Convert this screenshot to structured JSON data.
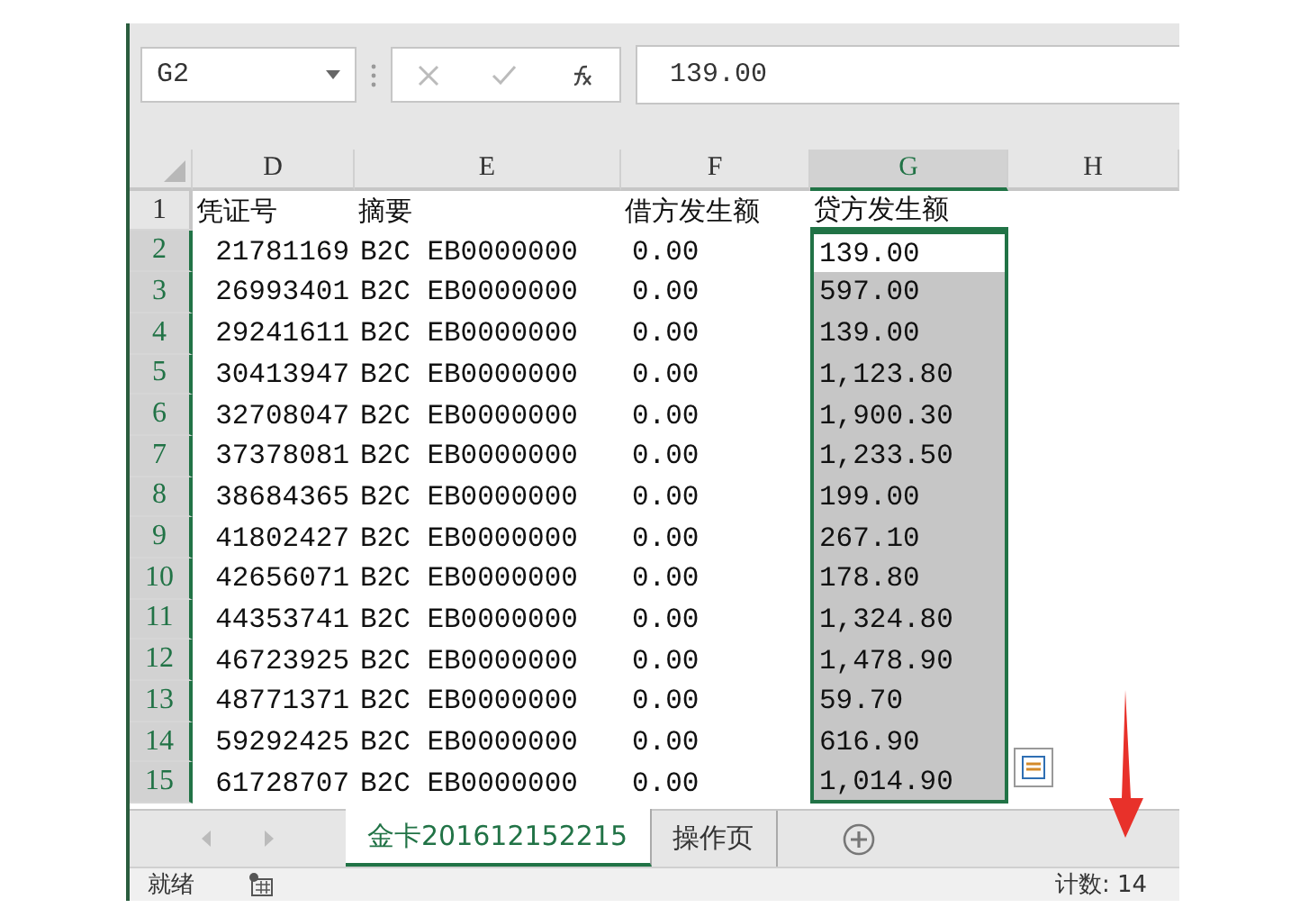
{
  "formula_bar": {
    "name_box": "G2",
    "formula": "139.00"
  },
  "columns": [
    {
      "label": "D",
      "selected": false
    },
    {
      "label": "E",
      "selected": false
    },
    {
      "label": "F",
      "selected": false
    },
    {
      "label": "G",
      "selected": true
    },
    {
      "label": "H",
      "selected": false
    }
  ],
  "header_row": {
    "num": "1",
    "cells": [
      "凭证号",
      "摘要",
      "借方发生额",
      "贷方发生额"
    ]
  },
  "rows": [
    {
      "num": "2",
      "d": "21781169",
      "e": "B2C EB0000000",
      "f": "0.00",
      "g": "139.00",
      "selected": true,
      "active": true
    },
    {
      "num": "3",
      "d": "26993401",
      "e": "B2C EB0000000",
      "f": "0.00",
      "g": "597.00",
      "selected": true,
      "active": false
    },
    {
      "num": "4",
      "d": "29241611",
      "e": "B2C EB0000000",
      "f": "0.00",
      "g": "139.00",
      "selected": true,
      "active": false
    },
    {
      "num": "5",
      "d": "30413947",
      "e": "B2C EB0000000",
      "f": "0.00",
      "g": "1,123.80",
      "selected": true,
      "active": false
    },
    {
      "num": "6",
      "d": "32708047",
      "e": "B2C EB0000000",
      "f": "0.00",
      "g": "1,900.30",
      "selected": true,
      "active": false
    },
    {
      "num": "7",
      "d": "37378081",
      "e": "B2C EB0000000",
      "f": "0.00",
      "g": "1,233.50",
      "selected": true,
      "active": false
    },
    {
      "num": "8",
      "d": "38684365",
      "e": "B2C EB0000000",
      "f": "0.00",
      "g": "199.00",
      "selected": true,
      "active": false
    },
    {
      "num": "9",
      "d": "41802427",
      "e": "B2C EB0000000",
      "f": "0.00",
      "g": "267.10",
      "selected": true,
      "active": false
    },
    {
      "num": "10",
      "d": "42656071",
      "e": "B2C EB0000000",
      "f": "0.00",
      "g": "178.80",
      "selected": true,
      "active": false
    },
    {
      "num": "11",
      "d": "44353741",
      "e": "B2C EB0000000",
      "f": "0.00",
      "g": "1,324.80",
      "selected": true,
      "active": false
    },
    {
      "num": "12",
      "d": "46723925",
      "e": "B2C EB0000000",
      "f": "0.00",
      "g": "1,478.90",
      "selected": true,
      "active": false
    },
    {
      "num": "13",
      "d": "48771371",
      "e": "B2C EB0000000",
      "f": "0.00",
      "g": "59.70",
      "selected": true,
      "active": false
    },
    {
      "num": "14",
      "d": "59292425",
      "e": "B2C EB0000000",
      "f": "0.00",
      "g": "616.90",
      "selected": true,
      "active": false
    },
    {
      "num": "15",
      "d": "61728707",
      "e": "B2C EB0000000",
      "f": "0.00",
      "g": "1,014.90",
      "selected": true,
      "active": false
    }
  ],
  "sheet_tabs": [
    {
      "label": "金卡201612152215",
      "selected": true
    },
    {
      "label": "操作页",
      "selected": false
    }
  ],
  "status_bar": {
    "status": "就绪",
    "count": "计数: 14"
  }
}
